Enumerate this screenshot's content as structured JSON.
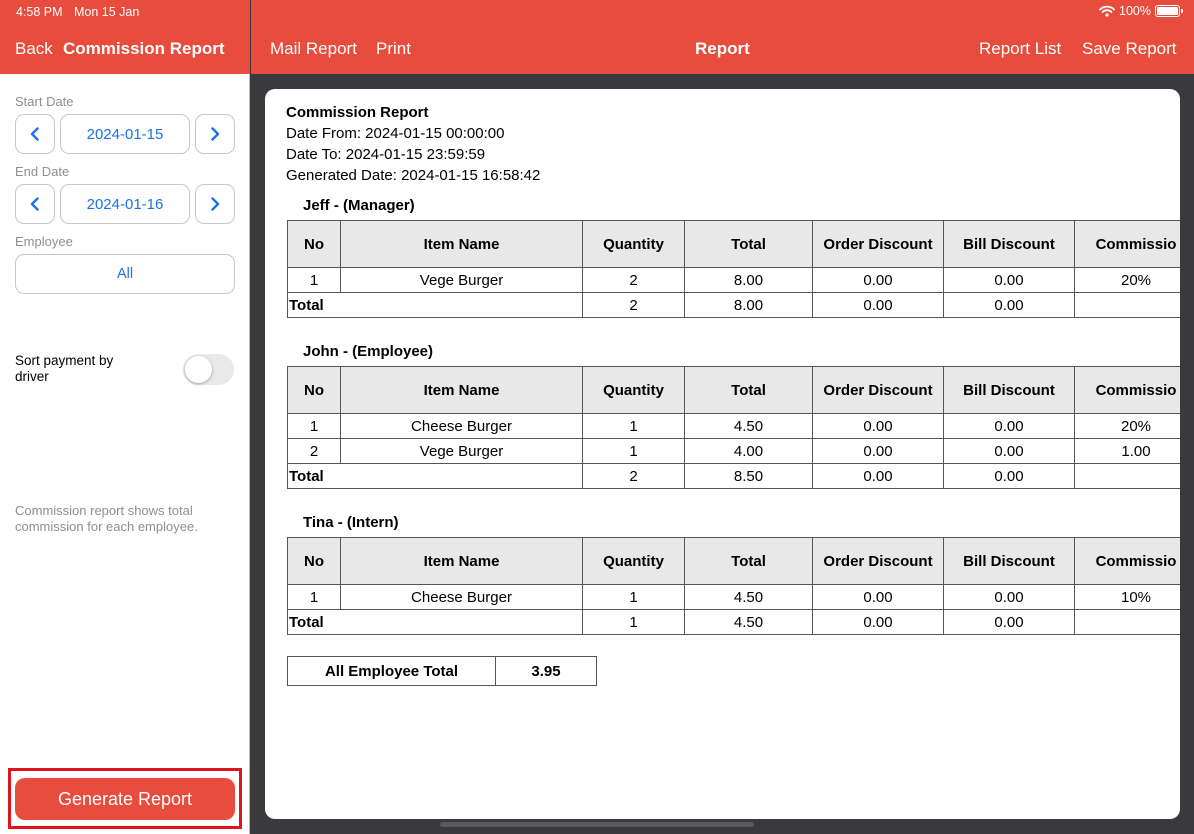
{
  "status": {
    "time": "4:58 PM",
    "date": "Mon 15 Jan",
    "battery": "100%"
  },
  "left_panel": {
    "back_label": "Back",
    "title": "Commission Report",
    "start_date_label": "Start Date",
    "start_date_value": "2024-01-15",
    "end_date_label": "End Date",
    "end_date_value": "2024-01-16",
    "employee_label": "Employee",
    "employee_value": "All",
    "sort_label": "Sort payment by driver",
    "sort_enabled": false,
    "hint": "Commission report shows total commission for each employee.",
    "generate_label": "Generate Report"
  },
  "toolbar": {
    "mail_label": "Mail Report",
    "print_label": "Print",
    "title": "Report",
    "report_list_label": "Report List",
    "save_label": "Save Report"
  },
  "colors": {
    "accent": "#e74c3c",
    "link": "#1a73e8"
  },
  "report": {
    "title": "Commission Report",
    "date_from": "Date From: 2024-01-15 00:00:00",
    "date_to": "Date To: 2024-01-15 23:59:59",
    "generated": "Generated Date: 2024-01-15 16:58:42",
    "columns": [
      "No",
      "Item Name",
      "Quantity",
      "Total",
      "Order Discount",
      "Bill Discount",
      "Commissio"
    ],
    "total_label": "Total",
    "employees": [
      {
        "name": "Jeff - (Manager)",
        "rows": [
          [
            "1",
            "Vege Burger",
            "2",
            "8.00",
            "0.00",
            "0.00",
            "20%"
          ]
        ],
        "total": [
          "2",
          "8.00",
          "0.00",
          "0.00",
          ""
        ]
      },
      {
        "name": "John - (Employee)",
        "rows": [
          [
            "1",
            "Cheese Burger",
            "1",
            "4.50",
            "0.00",
            "0.00",
            "20%"
          ],
          [
            "2",
            "Vege Burger",
            "1",
            "4.00",
            "0.00",
            "0.00",
            "1.00"
          ]
        ],
        "total": [
          "2",
          "8.50",
          "0.00",
          "0.00",
          ""
        ]
      },
      {
        "name": "Tina - (Intern)",
        "rows": [
          [
            "1",
            "Cheese Burger",
            "1",
            "4.50",
            "0.00",
            "0.00",
            "10%"
          ]
        ],
        "total": [
          "1",
          "4.50",
          "0.00",
          "0.00",
          ""
        ]
      }
    ],
    "grand_total_label": "All Employee Total",
    "grand_total_value": "3.95"
  }
}
